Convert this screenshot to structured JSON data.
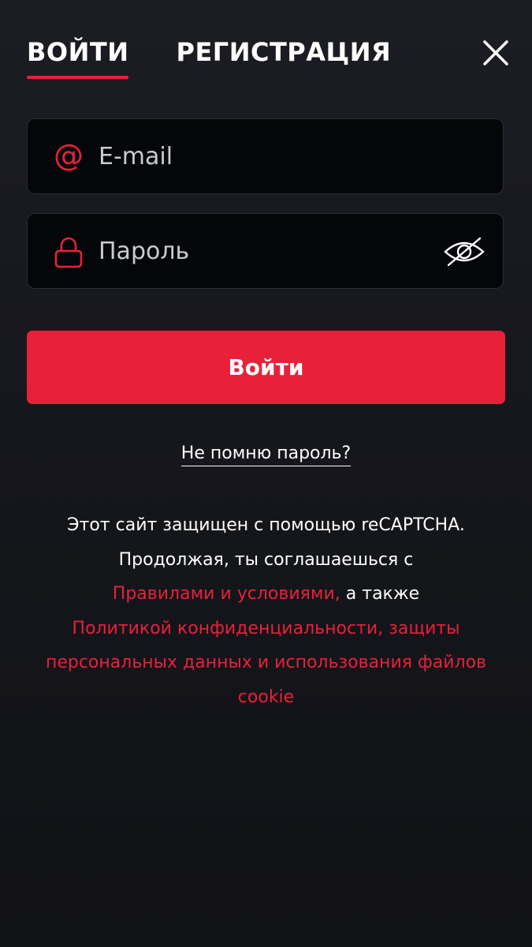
{
  "tabs": {
    "login": "ВОЙТИ",
    "register": "РЕГИСТРАЦИЯ"
  },
  "form": {
    "email_placeholder": "E-mail",
    "email_value": "",
    "password_placeholder": "Пароль",
    "password_value": "",
    "submit_label": "Войти",
    "forgot_label": "Не помню пароль?"
  },
  "legal": {
    "line1": "Этот сайт защищен с помощью reCAPTCHA.",
    "line2": "Продолжая, ты соглашаешься с",
    "terms_link": "Правилами и условиями,",
    "conjunction": " а также",
    "privacy_link": "Политикой конфиденциальности, защиты персональных данных и использования файлов cookie"
  },
  "icons": {
    "close": "close-icon",
    "email": "at-sign-icon",
    "password": "lock-icon",
    "visibility": "eye-off-icon"
  },
  "colors": {
    "accent": "#e8213a",
    "background": "#16171c",
    "field_background": "#050609",
    "text": "#ffffff"
  }
}
